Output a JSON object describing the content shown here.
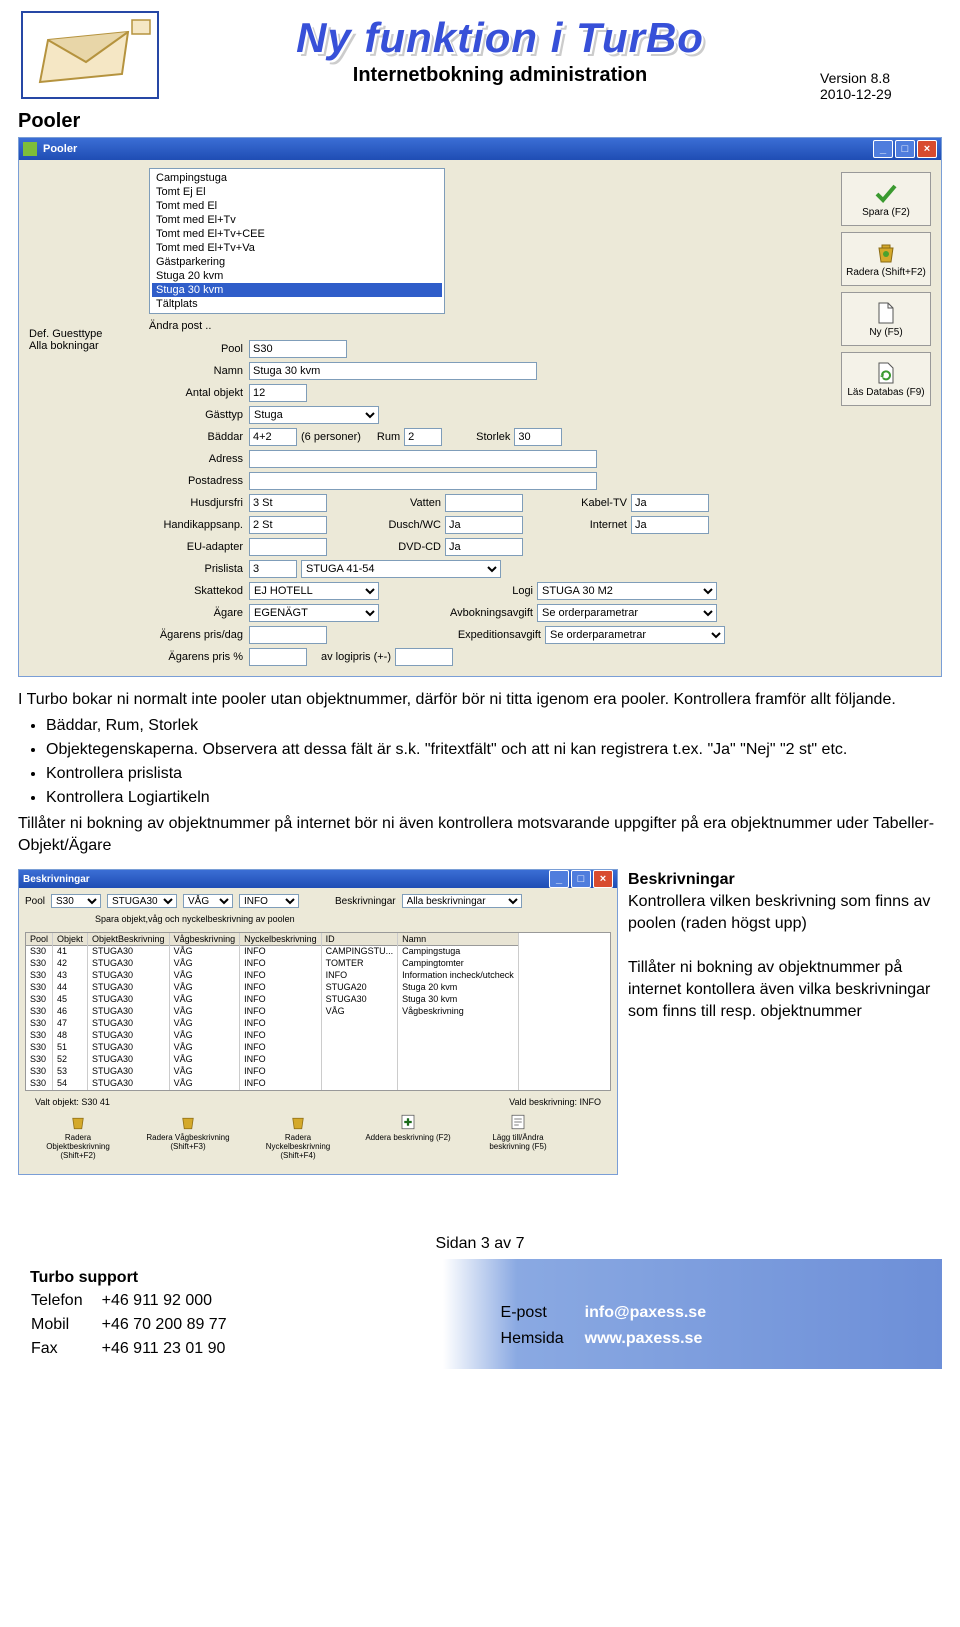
{
  "header": {
    "title_art": "Ny funktion i TurBo",
    "subtitle": "Internetbokning administration",
    "version": "Version 8.8",
    "date": "2010-12-29"
  },
  "section_heading": "Pooler",
  "pooler_window": {
    "title": "Pooler",
    "left_label_1": "Def. Guesttype",
    "left_label_2": "Alla bokningar",
    "list_items": [
      "Campingstuga",
      "Tomt Ej El",
      "Tomt med El",
      "Tomt med El+Tv",
      "Tomt med El+Tv+CEE",
      "Tomt med El+Tv+Va",
      "Gästparkering",
      "Stuga 20 kvm",
      "Stuga 30 kvm",
      "Tältplats"
    ],
    "selected_index": 8,
    "andra": "Ändra post ..",
    "buttons": {
      "spara": "Spara (F2)",
      "radera": "Radera (Shift+F2)",
      "ny": "Ny (F5)",
      "las": "Läs Databas (F9)"
    },
    "labels": {
      "pool": "Pool",
      "namn": "Namn",
      "antal": "Antal objekt",
      "gasttyp": "Gästtyp",
      "baddar": "Bäddar",
      "pers": "(6 personer)",
      "rum": "Rum",
      "storlek": "Storlek",
      "adress": "Adress",
      "postadress": "Postadress",
      "husdjur": "Husdjursfri",
      "vatten": "Vatten",
      "kabel": "Kabel-TV",
      "handikapp": "Handikappsanp.",
      "dusch": "Dusch/WC",
      "internet": "Internet",
      "eu": "EU-adapter",
      "dvd": "DVD-CD",
      "prislista": "Prislista",
      "skattekod": "Skattekod",
      "logi": "Logi",
      "agare": "Ägare",
      "avbok": "Avbokningsavgift",
      "agpris": "Ägarens pris/dag",
      "exped": "Expeditionsavgift",
      "agprispct": "Ägarens pris %",
      "avlogi": "av logipris (+-)"
    },
    "values": {
      "pool": "S30",
      "namn": "Stuga 30 kvm",
      "antal": "12",
      "gasttyp": "Stuga",
      "baddar": "4+2",
      "rum": "2",
      "storlek": "30",
      "adress": "",
      "postadress": "",
      "husdjur": "3 St",
      "vatten": "",
      "kabel": "Ja",
      "handikapp": "2 St",
      "dusch": "Ja",
      "internet": "Ja",
      "eu": "",
      "dvd": "Ja",
      "prislista_nr": "3",
      "prislista_name": "STUGA 41-54",
      "skattekod": "EJ HOTELL",
      "logi": "STUGA 30 M2",
      "agare": "EGENÄGT",
      "avbok": "Se orderparametrar",
      "agpris": "",
      "exped": "Se orderparametrar",
      "agprispct": "",
      "avlogi": ""
    }
  },
  "paragraphs": {
    "p1": "I Turbo bokar ni normalt inte pooler utan objektnummer, därför bör ni titta igenom era pooler. Kontrollera framför allt följande.",
    "bullets": [
      "Bäddar, Rum, Storlek",
      "Objektegenskaperna. Observera att dessa fält är s.k. \"fritextfält\" och att ni kan registrera t.ex. \"Ja\" \"Nej\" \"2 st\" etc.",
      "Kontrollera prislista",
      "Kontrollera Logiartikeln"
    ],
    "p2": "Tillåter ni bokning av objektnummer på internet bör ni även kontrollera motsvarande uppgifter på era objektnummer uder Tabeller-Objekt/Ägare"
  },
  "desc_window": {
    "title": "Beskrivningar",
    "pool_label": "Pool",
    "pool_val": "S30",
    "d1": "STUGA30",
    "d2": "VÅG",
    "d3": "INFO",
    "besk_label": "Beskrivningar",
    "besk_val": "Alla beskrivningar",
    "save_label": "Spara objekt,våg och nyckelbeskrivning av poolen",
    "table": {
      "headers": [
        "Pool",
        "Objekt",
        "ObjektBeskrivning",
        "Vågbeskrivning",
        "Nyckelbeskrivning",
        "ID",
        "Namn"
      ],
      "rows": [
        [
          "S30",
          "41",
          "STUGA30",
          "VÅG",
          "INFO",
          "CAMPINGSTU...",
          "Campingstuga"
        ],
        [
          "S30",
          "42",
          "STUGA30",
          "VÅG",
          "INFO",
          "TOMTER",
          "Campingtomter"
        ],
        [
          "S30",
          "43",
          "STUGA30",
          "VÅG",
          "INFO",
          "INFO",
          "Information incheck/utcheck"
        ],
        [
          "S30",
          "44",
          "STUGA30",
          "VÅG",
          "INFO",
          "STUGA20",
          "Stuga 20 kvm"
        ],
        [
          "S30",
          "45",
          "STUGA30",
          "VÅG",
          "INFO",
          "STUGA30",
          "Stuga 30 kvm"
        ],
        [
          "S30",
          "46",
          "STUGA30",
          "VÅG",
          "INFO",
          "VÅG",
          "Vågbeskrivning"
        ],
        [
          "S30",
          "47",
          "STUGA30",
          "VÅG",
          "INFO",
          "",
          ""
        ],
        [
          "S30",
          "48",
          "STUGA30",
          "VÅG",
          "INFO",
          "",
          ""
        ],
        [
          "S30",
          "51",
          "STUGA30",
          "VÅG",
          "INFO",
          "",
          ""
        ],
        [
          "S30",
          "52",
          "STUGA30",
          "VÅG",
          "INFO",
          "",
          ""
        ],
        [
          "S30",
          "53",
          "STUGA30",
          "VÅG",
          "INFO",
          "",
          ""
        ],
        [
          "S30",
          "54",
          "STUGA30",
          "VÅG",
          "INFO",
          "",
          ""
        ]
      ]
    },
    "status_left": "Valt objekt: S30 41",
    "status_right": "Vald beskrivning: INFO",
    "btns": [
      "Radera Objektbeskrivning (Shift+F2)",
      "Radera Vågbeskrivning (Shift+F3)",
      "Radera Nyckelbeskrivning (Shift+F4)",
      "Addera beskrivning (F2)",
      "Lägg till/Ändra beskrivning (F5)"
    ]
  },
  "desc_text": {
    "h": "Beskrivningar",
    "p1": "Kontrollera vilken beskrivning som finns av poolen (raden högst upp)",
    "p2": "Tillåter ni bokning av objektnummer på internet kontollera även vilka beskrivningar som finns till resp. objektnummer"
  },
  "page_num": "Sidan 3 av 7",
  "footer": {
    "support": "Turbo support",
    "tel_l": "Telefon",
    "tel_v": "+46 911 92 000",
    "mob_l": "Mobil",
    "mob_v": "+46 70 200 89 77",
    "fax_l": "Fax",
    "fax_v": "+46 911 23 01 90",
    "ep_l": "E-post",
    "ep_v": "info@paxess.se",
    "hs_l": "Hemsida",
    "hs_v": "www.paxess.se"
  }
}
